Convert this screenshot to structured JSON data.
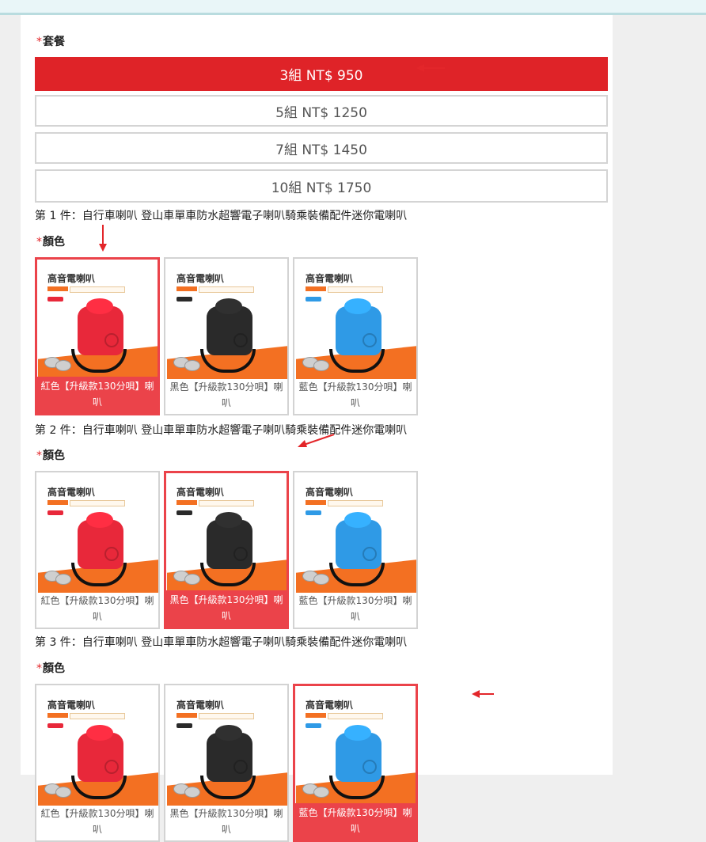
{
  "package": {
    "required_mark": "*",
    "label": "套餐",
    "options": [
      {
        "label": "3組 NT$ 950",
        "selected": true
      },
      {
        "label": "5組 NT$ 1250",
        "selected": false
      },
      {
        "label": "7組 NT$ 1450",
        "selected": false
      },
      {
        "label": "10組 NT$ 1750",
        "selected": false
      }
    ]
  },
  "items": [
    {
      "title": "第 1 件：自行車喇叭 登山車單車防水超響電子喇叭騎乘裝備配件迷你電喇叭",
      "color_label": "顏色",
      "options": [
        {
          "caption": "紅色【升級款130分唄】喇叭",
          "selected": true,
          "color": "#e8283a"
        },
        {
          "caption": "黑色【升級款130分唄】喇叭",
          "selected": false,
          "color": "#2a2a2a"
        },
        {
          "caption": "藍色【升級款130分唄】喇叭",
          "selected": false,
          "color": "#2f9ae6"
        }
      ]
    },
    {
      "title": "第 2 件：自行車喇叭 登山車單車防水超響電子喇叭騎乘裝備配件迷你電喇叭",
      "color_label": "顏色",
      "options": [
        {
          "caption": "紅色【升級款130分唄】喇叭",
          "selected": false,
          "color": "#e8283a"
        },
        {
          "caption": "黑色【升級款130分唄】喇叭",
          "selected": true,
          "color": "#2a2a2a"
        },
        {
          "caption": "藍色【升級款130分唄】喇叭",
          "selected": false,
          "color": "#2f9ae6"
        }
      ]
    },
    {
      "title": "第 3 件：自行車喇叭 登山車單車防水超響電子喇叭騎乘裝備配件迷你電喇叭",
      "color_label": "顏色",
      "options": [
        {
          "caption": "紅色【升級款130分唄】喇叭",
          "selected": false,
          "color": "#e8283a"
        },
        {
          "caption": "黑色【升級款130分唄】喇叭",
          "selected": false,
          "color": "#2a2a2a"
        },
        {
          "caption": "藍色【升級款130分唄】喇叭",
          "selected": true,
          "color": "#2f9ae6"
        }
      ]
    }
  ],
  "product_image_title": "高音電喇叭",
  "accent_color": "#df2328",
  "selected_border_color": "#eb434a"
}
